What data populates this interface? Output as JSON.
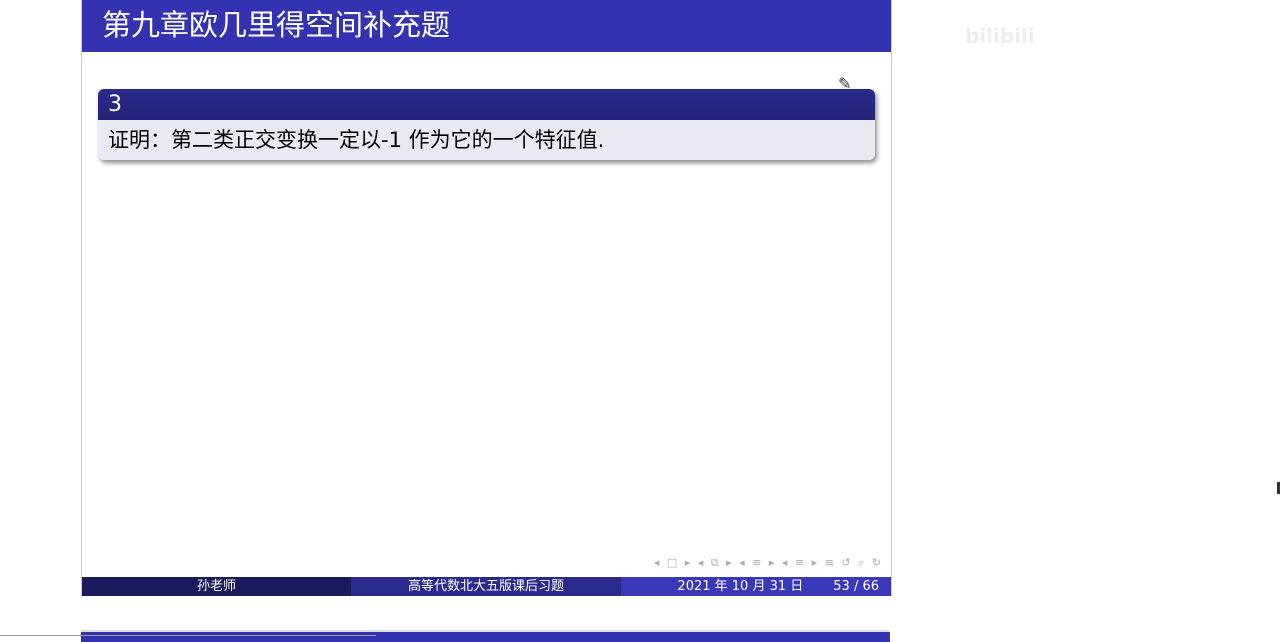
{
  "header": {
    "title": "第九章欧几里得空间补充题"
  },
  "block": {
    "title": "3",
    "body": "证明：第二类正交变换一定以-1 作为它的一个特征值."
  },
  "nav": {
    "symbols": "◂ □ ▸ ◂ ⧉ ▸ ◂ ≡ ▸ ◂ ≡ ▸  ≡  ↺ ⌕ ↻"
  },
  "footer": {
    "author": "孙老师",
    "course": "高等代数北大五版课后习题",
    "date": "2021 年 10 月 31 日",
    "page": "53 / 66"
  },
  "watermark": {
    "logo": "bilibili"
  }
}
